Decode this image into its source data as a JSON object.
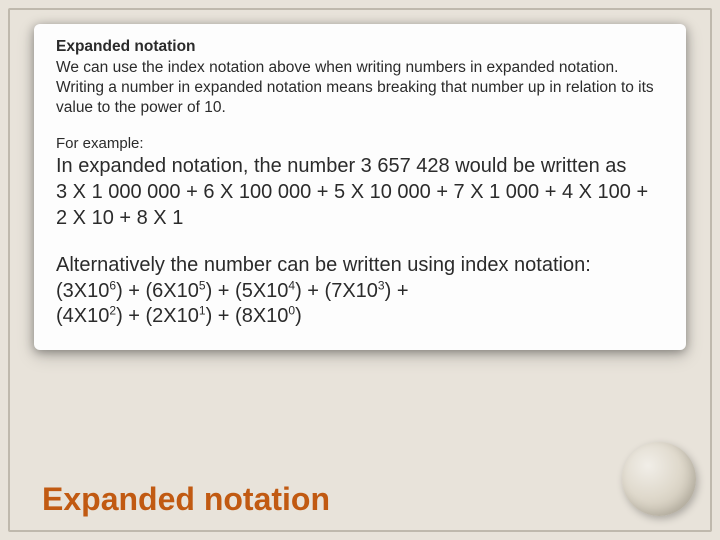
{
  "card": {
    "heading": "Expanded notation",
    "intro_l1": "We can use the index notation above when writing numbers in expanded notation.",
    "intro_l2": "Writing a number in expanded notation means breaking that number up in relation to its value to the power of 10.",
    "for_example": "For example:",
    "exp_l1": "In expanded notation, the number 3 657 428 would be written as",
    "exp_l2": "3 X 1 000 000 + 6 X 100 000 + 5 X 10 000 + 7 X 1 000 + 4 X 100 + 2 X 10 + 8 X 1",
    "alt_intro": "Alternatively the number can be written using index notation:",
    "idx": {
      "t1_base": "(3X10",
      "t1_sup": "6",
      "t1_tail": ") + ",
      "t2_base": "(6X10",
      "t2_sup": "5",
      "t2_tail": ") + ",
      "t3_base": "(5X10",
      "t3_sup": "4",
      "t3_tail": ") + ",
      "t4_base": "(7X10",
      "t4_sup": "3",
      "t4_tail": ") + ",
      "t5_base": "(4X10",
      "t5_sup": "2",
      "t5_tail": ") + ",
      "t6_base": "(2X10",
      "t6_sup": "1",
      "t6_tail": ") + ",
      "t7_base": "(8X10",
      "t7_sup": "0",
      "t7_tail": ")"
    }
  },
  "footer_title": "Expanded notation"
}
